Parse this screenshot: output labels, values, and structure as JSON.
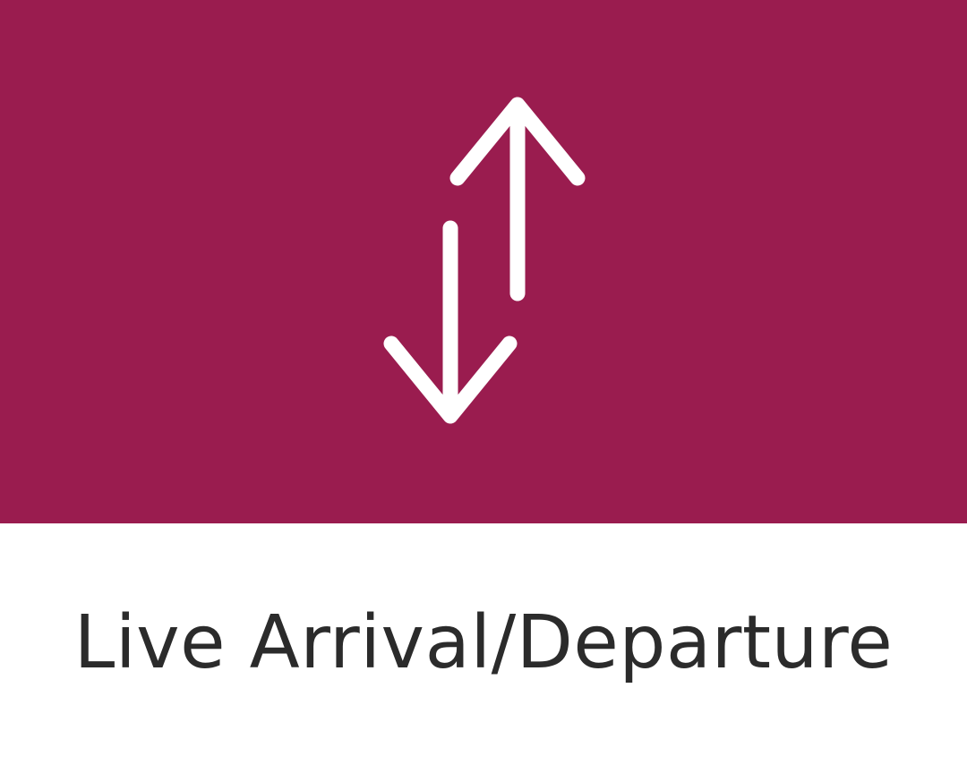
{
  "tile": {
    "label": "Live Arrival/Departure",
    "icon": "arrows-up-down-icon",
    "colors": {
      "banner": "#9a1c4f",
      "icon": "#ffffff",
      "label": "#2b2b2b",
      "background": "#ffffff"
    }
  }
}
